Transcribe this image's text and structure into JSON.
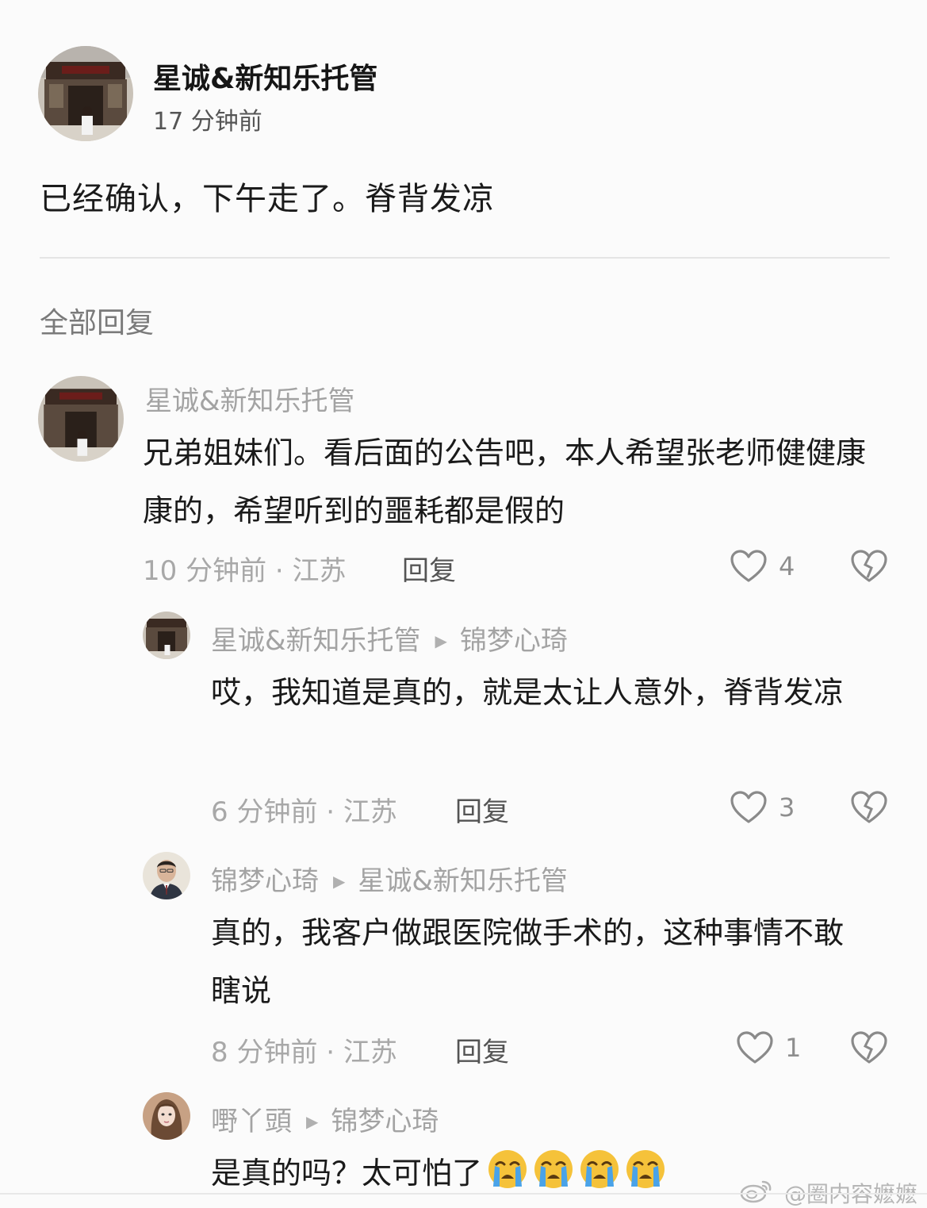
{
  "post": {
    "author": "星诚&新知乐托管",
    "time": "17 分钟前",
    "body": "已经确认，下午走了。脊背发凉"
  },
  "replies_title": "全部回复",
  "comments": [
    {
      "author": "星诚&新知乐托管",
      "reply_to": "",
      "body": "兄弟姐妹们。看后面的公告吧，本人希望张老师健健康康的，希望听到的噩耗都是假的",
      "meta": "10 分钟前 · 江苏",
      "reply_label": "回复",
      "likes": "4",
      "avatar_icon": "building-avatar"
    },
    {
      "author": "星诚&新知乐托管",
      "reply_to": "锦梦心琦",
      "body": "哎，我知道是真的，就是太让人意外，脊背发凉",
      "meta": "6 分钟前 · 江苏",
      "reply_label": "回复",
      "likes": "3",
      "avatar_icon": "building-avatar"
    },
    {
      "author": "锦梦心琦",
      "reply_to": "星诚&新知乐托管",
      "body": "真的，我客户做跟医院做手术的，这种事情不敢瞎说",
      "meta": "8 分钟前 · 江苏",
      "reply_label": "回复",
      "likes": "1",
      "avatar_icon": "man-portrait-avatar"
    },
    {
      "author": "嘢丫頭",
      "reply_to": "锦梦心琦",
      "body": "是真的吗？太可怕了",
      "avatar_icon": "woman-portrait-avatar",
      "emoji": "loudly-crying-face"
    }
  ],
  "watermark": "@圈内容嬷嬷",
  "icons": {
    "like": "heart-outline-icon",
    "dislike": "broken-heart-icon",
    "reply_arrow": "triangle-right-icon"
  },
  "colors": {
    "background": "#fbfbfb",
    "name_gray": "#a3a3a3",
    "emoji_yellow": "#f5c23a",
    "emoji_tears": "#4aa3e8"
  }
}
